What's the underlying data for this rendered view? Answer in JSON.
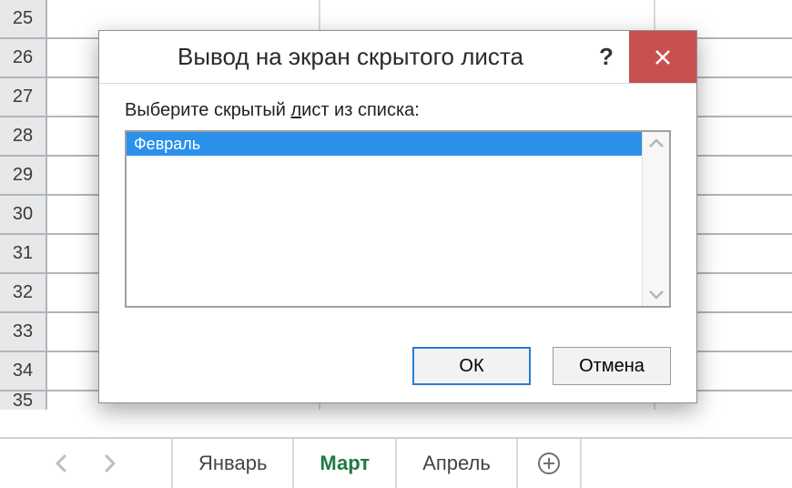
{
  "rows": [
    "25",
    "26",
    "27",
    "28",
    "29",
    "30",
    "31",
    "32",
    "33",
    "34",
    "35"
  ],
  "tabs": [
    {
      "label": "Январь",
      "active": false
    },
    {
      "label": "Март",
      "active": true
    },
    {
      "label": "Апрель",
      "active": false
    }
  ],
  "dialog": {
    "title": "Вывод на экран скрытого листа",
    "prompt_prefix": "Выберите скрытый ",
    "prompt_mn": "л",
    "prompt_suffix": "ист из списка:",
    "items": [
      "Февраль"
    ],
    "ok": "ОК",
    "cancel": "Отмена",
    "help_symbol": "?"
  },
  "icons": {
    "new_sheet": "⊕"
  }
}
